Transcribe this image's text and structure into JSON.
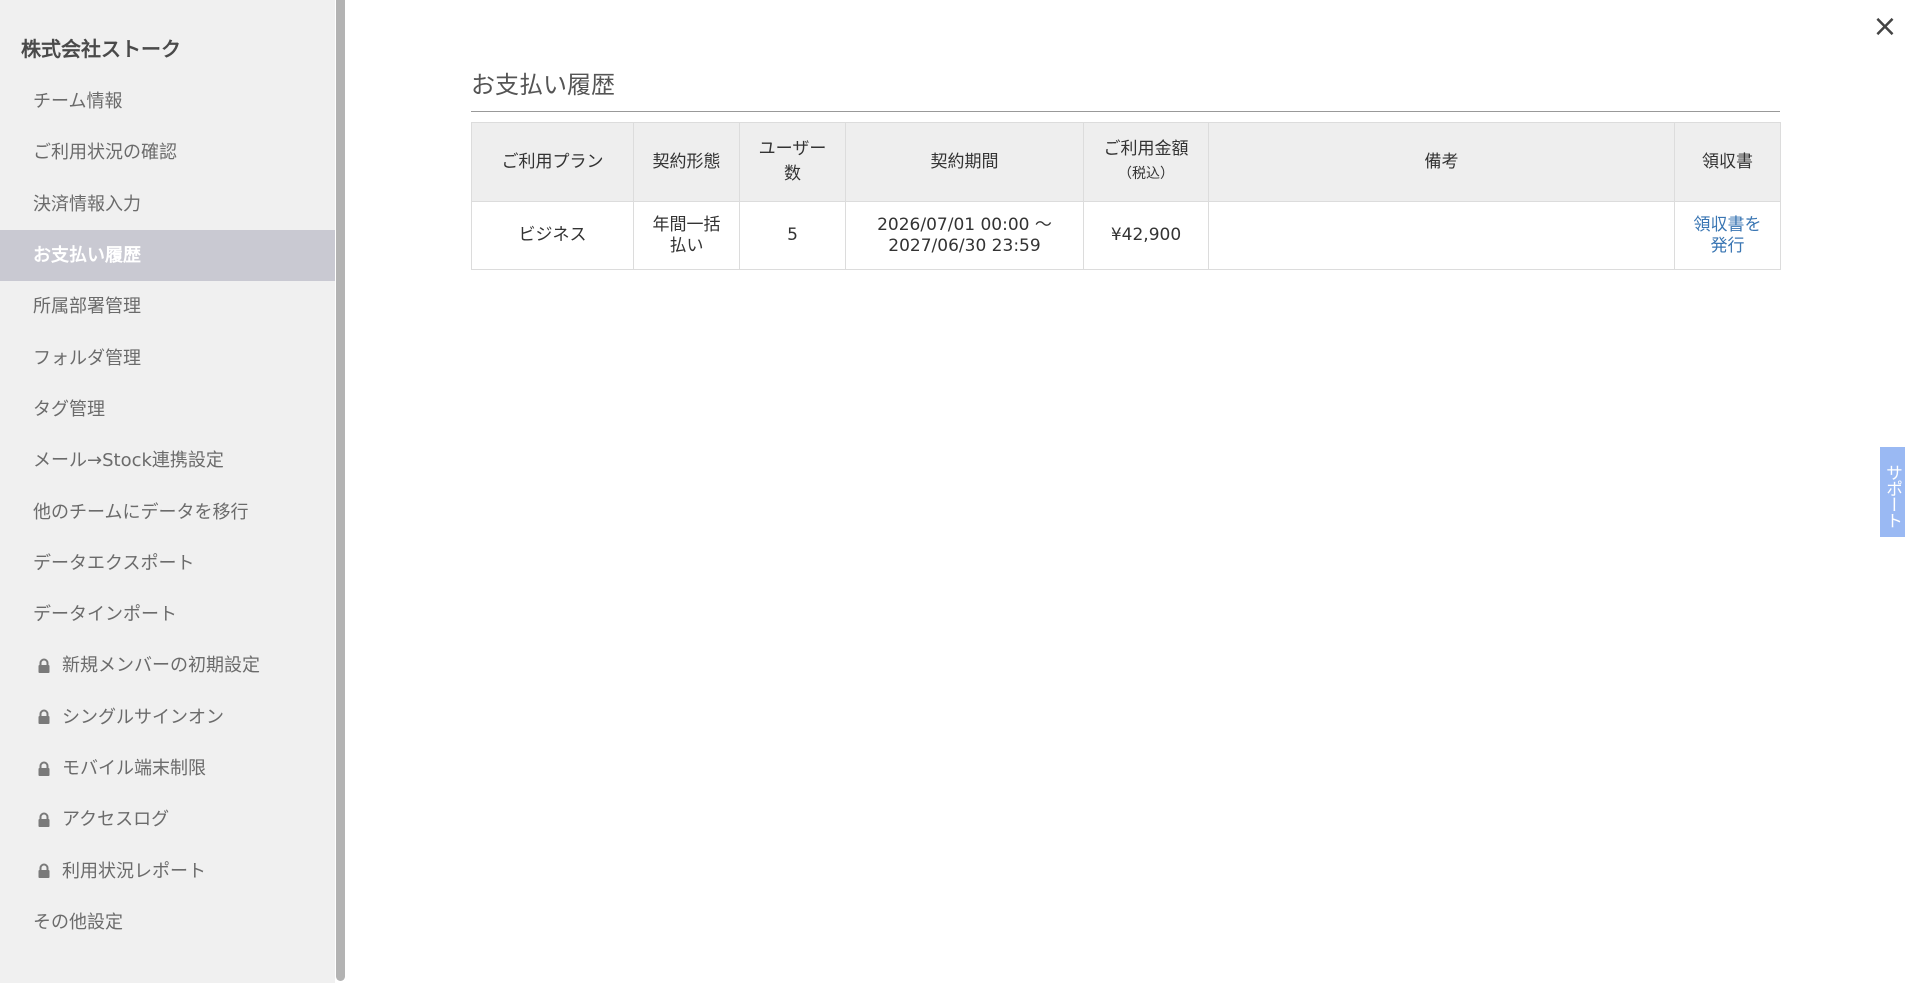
{
  "sidebar": {
    "team_name": "株式会社ストーク",
    "items": [
      {
        "label": "チーム情報"
      },
      {
        "label": "ご利用状況の確認"
      },
      {
        "label": "決済情報入力"
      },
      {
        "label": "お支払い履歴"
      },
      {
        "label": "所属部署管理"
      },
      {
        "label": "フォルダ管理"
      },
      {
        "label": "タグ管理"
      },
      {
        "label": "メール→Stock連携設定"
      },
      {
        "label": "他のチームにデータを移行"
      },
      {
        "label": "データエクスポート"
      },
      {
        "label": "データインポート"
      },
      {
        "label": "新規メンバーの初期設定",
        "icon": "lock-icon"
      },
      {
        "label": "シングルサインオン",
        "icon": "lock-icon"
      },
      {
        "label": "モバイル端末制限",
        "icon": "lock-icon"
      },
      {
        "label": "アクセスログ",
        "icon": "lock-icon"
      },
      {
        "label": "利用状況レポート",
        "icon": "lock-icon"
      },
      {
        "label": "その他設定"
      }
    ],
    "active_label": "お支払い履歴"
  },
  "close": {
    "label": "×"
  },
  "main": {
    "title": "お支払い履歴",
    "table": {
      "headers": {
        "plan": "ご利用プラン",
        "contract_type": "契約形態",
        "users_1": "ユーザー",
        "users_2": "数",
        "period": "契約期間",
        "amount": "ご利用金額",
        "amount_note": "（税込）",
        "notes": "備考",
        "receipt": "領収書"
      },
      "rows": [
        {
          "plan": "ビジネス",
          "contract_type_1": "年間一括",
          "contract_type_2": "払い",
          "users": "5",
          "period_start": "2026/07/01 00:00 〜",
          "period_end": "2027/06/30 23:59",
          "amount": "¥42,900",
          "notes": "",
          "receipt_link_1": "領収書を",
          "receipt_link_2": "発行"
        }
      ]
    }
  },
  "support_tab": {
    "label": "サポート"
  },
  "colors": {
    "sidebar_bg": "#f0f0f0",
    "active_item_bg": "#c9c9d2",
    "link": "#3a76b3",
    "support_tab_bg": "#9ab9f3",
    "table_header_bg": "#eeeeee"
  }
}
